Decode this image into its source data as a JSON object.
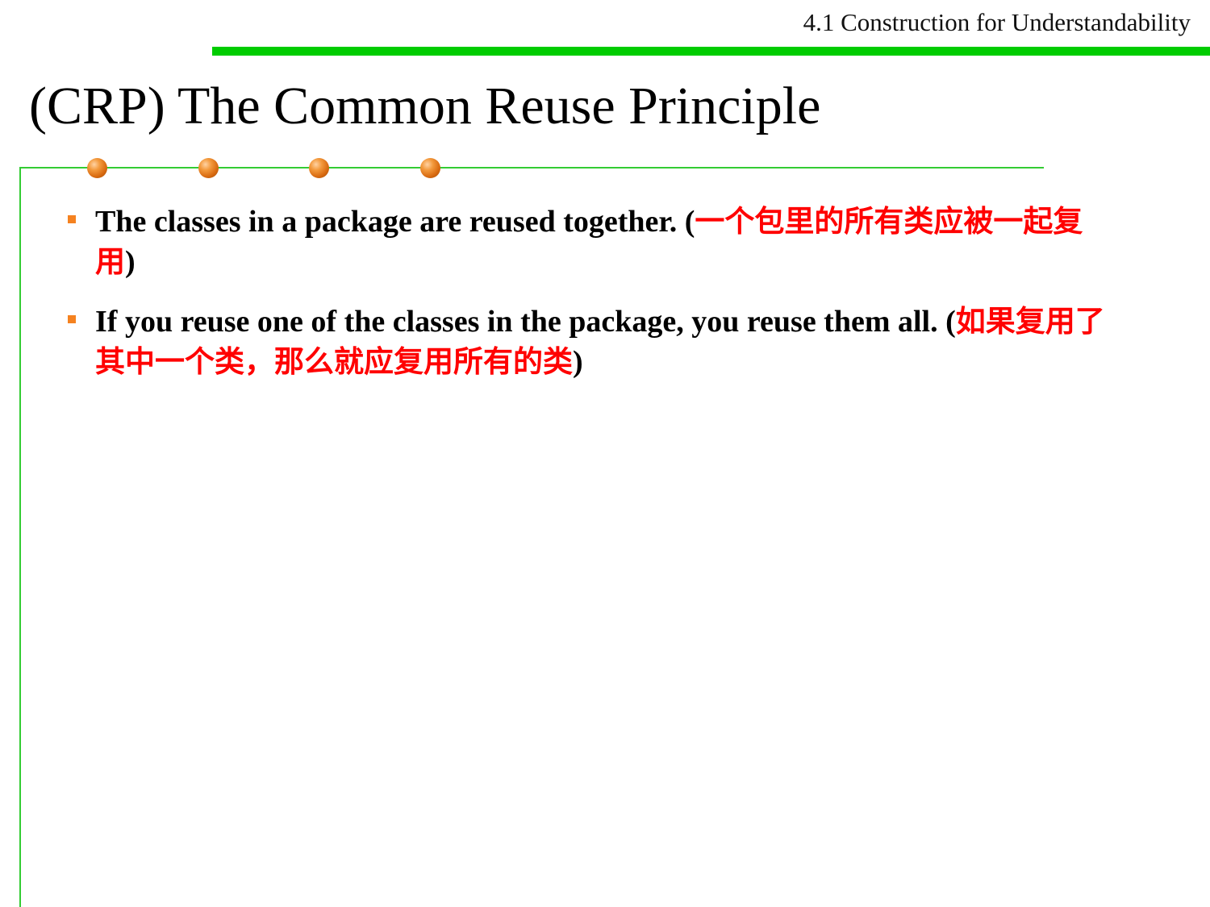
{
  "header": {
    "section": "4.1 Construction for Understandability"
  },
  "slide": {
    "title": "(CRP) The Common Reuse Principle"
  },
  "bullets": [
    {
      "en": "The classes in a package are reused together. (",
      "zh": "一个包里的所有类应被一起复用",
      "close": ")"
    },
    {
      "en": "If you reuse one of the classes in the package, you reuse them all. (",
      "zh": "如果复用了其中一个类，那么就应复用所有的类",
      "close": ")"
    }
  ],
  "colors": {
    "accent_green": "#00cc00",
    "bullet_orange": "#f58220",
    "highlight_red": "#ff0000"
  }
}
